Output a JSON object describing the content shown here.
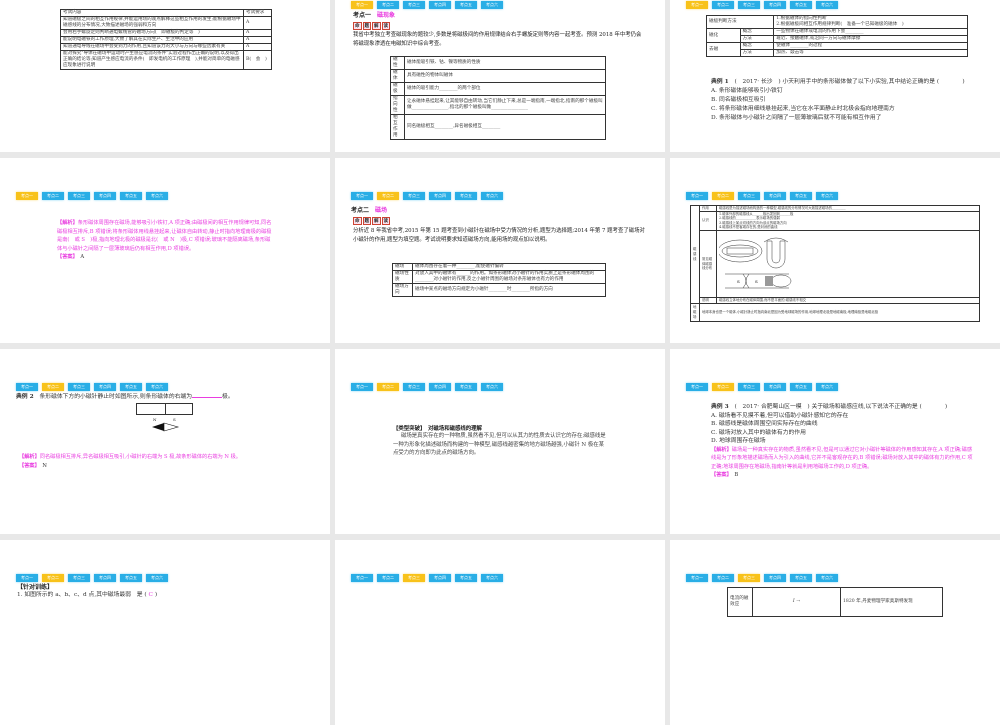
{
  "tabs": [
    "考点一",
    "考点二",
    "考点三",
    "考点四",
    "考点五",
    "考点六"
  ],
  "slide1": {
    "headers": [
      "考试内容",
      "考试要求"
    ],
    "rows": [
      [
        "知道磁极之间的相互作用规律,并能运用场的观点解释这些相互作用的发生;能根据磁场中磁感线的分布情况,大致描述磁场的强弱和方向",
        "A"
      ],
      [
        "会用右手螺旋定则判断通电螺线管的磁场方向(　即磁极的判定等　)",
        "A"
      ],
      [
        "能说明电磁铁的工作原理,大致了解其在实际生产、生活中的应用",
        "A"
      ],
      [
        "知道通电导线在磁场中会受到力的作用,且知道该力的大小与方向与哪些因素有关",
        "A"
      ],
      [
        "能对探究\"导体在磁场中运动时产生感应电流的条件\"实验过程作出正确的说明,以及得出正确的结论等;知道产生感应电流的条件(　即发电机的工作原理　),并能对简单的电磁感应现象进行说明",
        "B(　会　)"
      ]
    ]
  },
  "slide2": {
    "heading": "考点一",
    "topic": "磁现象",
    "badge": [
      "命",
      "题",
      "解",
      "读"
    ],
    "para": "我省中考独立考查磁现象的题较少,多数是将磁极间的作用规律结合右手螺旋定则等内容一起考查。预测 2018 年中考仍会将磁现象渗透在电磁知识中综合考查。",
    "rows": [
      [
        "磁性",
        "磁体能吸引铁、钴、镍等物质的性质"
      ],
      [
        "磁体",
        "具有磁性的物体叫磁体"
      ],
      [
        "磁极",
        "磁体的吸引能力________的两个部位"
      ],
      [
        "指向性",
        "让永磁体悬挂起来,让其能够自由转动,当它们静止下来,总是一端指南,一端指北,指南的那个磁极叫做________________,指北的那个磁极叫做________________"
      ],
      [
        "相互作用",
        "同名磁极相互________,异名磁极相互________"
      ]
    ]
  },
  "slide3": {
    "rows": [
      [
        "磁极判断方法",
        "",
        "1.根据磁体的指向性判断\n2.根据磁极间相互作用规律判断(　准备一个已知磁极的磁体　)"
      ],
      [
        "磁化",
        "概念",
        "一些物体在磁体或电流的作用下会________"
      ],
      [
        "",
        "方法",
        "靠近、接触磁体,或沿同一方向与磁体摩擦"
      ],
      [
        "去磁",
        "概念",
        "使磁体________的过程"
      ],
      [
        "",
        "方法",
        "加热、敲击等"
      ]
    ],
    "example_label": "典例 1",
    "example": "(　2017· 长沙　) 小天利用手中的条形磁体做了以下小实验,其中结论正确的是 (　　　　)",
    "options": [
      "A. 条形磁体能够吸引小铁钉",
      "B. 同名磁极相互吸引",
      "C. 将条形磁体用细线悬挂起来,当它在水平面静止时北极会指向地理南方",
      "D. 条形磁体与小磁针之间隔了一层薄玻璃后就不可能有相互作用了"
    ]
  },
  "slide4": {
    "analysis_label": "【解析】",
    "analysis": "条形磁体周围存在磁场,能够吸引小铁钉,A 项正确;由磁极间的相互作用规律可知,同名磁极相互排斥,B 项错误;将条形磁体用线悬挂起来,让磁体自由转动,静止时指向地理南极的磁极是南(　或 S　)极,指向地理北极的磁极是北(　或 N　)极,C 项错误;玻璃不能隔离磁场,条形磁体与小磁针之间隔了一层薄玻璃后仍有相互作用,D 项错误。",
    "answer_label": "【答案】",
    "answer": "A"
  },
  "slide5": {
    "heading": "考点二",
    "topic": "磁场",
    "badge": [
      "命",
      "题",
      "解",
      "读"
    ],
    "para": "分析近 8 年我省中考,2015 年第 15 题考查到小磁针在磁场中受力情况的分析,题型为选择题;2014 年第 7 题考查了磁场对小磁针的作用,题型为填空题。考试说明要求知道磁场方向,能用场的观点加以说明。",
    "rows": [
      [
        "磁场",
        "磁体周围存在着一种________,能使磁针偏转"
      ],
      [
        "磁场性质",
        "对放入其中的磁体有______的作用。如条形磁体对小磁针的作用实质上是条形磁体周围的________对小磁针的作用,反之小磁针周围的磁场对条形磁体也有力的作用"
      ],
      [
        "磁场方向",
        "磁场中某点的磁场方向规定为小磁针________时________所指的方向"
      ]
    ]
  },
  "slide6": {
    "group": "磁感线",
    "rows": [
      [
        "作用",
        "磁感线是为描述磁场而构造的一种模型,磁感线的分布情况可大致描述磁场的________"
      ],
      [
        "认识",
        "1.磁体外部的磁感线从______极出发回到______极\n2.磁感线的____________表示磁场的强弱\n3.磁感线上某点切线的方向为该点的磁场方向\n4.磁感线不是客观存在的,是封闭的曲线"
      ],
      [
        "常见磁体磁感线分布",
        ""
      ],
      [
        "说明",
        "磁感线立体地分布在磁体周围,而不是平面的;磁感线不相交"
      ]
    ],
    "earth_label": "地磁场",
    "earth": "地球本身也是一个磁体,小磁针静止时指向南北是因为受地球磁场的作用,地球地理北极是地磁南极,地理南极是地磁北极",
    "poles": [
      "N",
      "S"
    ]
  },
  "slide7": {
    "example_label": "典例 2",
    "example": "条形磁体下方的小磁针静止时如图所示,则条形磁体的右端为",
    "suffix": "极。",
    "needle": [
      "N",
      "S"
    ],
    "analysis_label": "【解析】",
    "analysis": "同名磁极相互排斥,异名磁极相互吸引,小磁针的右端为 S 极,故条形磁体的右端为 N 极。",
    "answer_label": "【答案】",
    "answer": "N"
  },
  "slide8": {
    "title": "【类型突破】　对磁场和磁感线的理解",
    "text": "磁场是真实存在的一种物质,虽然看不见,但可以从其力的性质去认识它的存在;磁感线是一种为形象化描述磁场而构建的一种模型,磁感线越密集的地方磁场越强,小磁针 N 极在某点受力的方向即为此点的磁场方向。"
  },
  "slide9": {
    "example_label": "典例 3",
    "example": "(　2017· 合肥蜀山区一模　) 关于磁场和磁感应线,以下说法不正确的是 (　　　　)",
    "options": [
      "A. 磁场看不见摸不着,但可以借助小磁针感知它的存在",
      "B. 磁感线是磁体周围空间实际存在的曲线",
      "C. 磁场对放入其中的磁体有力的作用",
      "D. 地球周围存在磁场"
    ],
    "analysis_label": "【解析】",
    "analysis": "磁场是一种真实存在的物质,虽然看不见,但是可以通过它对小磁针等磁体的作用感知其存在,A 项正确;磁感线是为了形象地描述磁场而人为引入的曲线,它并不是客观存在的,B 项错误;磁场对放入其中的磁体有力的作用,C 项正确;地球周围存在地磁场,指南针等就是利用地磁场工作的,D 项正确。",
    "answer_label": "【答案】",
    "answer": "B"
  },
  "slide10": {
    "title": "【针对训练】",
    "q": "1. 如图所示的 a、b、c、d 点,其中磁场最弱　是 (",
    "ans": "C",
    ")": ")"
  },
  "slide12": {
    "label": "电流的磁效应",
    "current": "I",
    "text": "1820 年,丹麦物理学家奥斯特发现"
  },
  "colors": {
    "tab": "#29aee6",
    "tab_active": "#f8c21a",
    "pink": "#e93ee0"
  }
}
